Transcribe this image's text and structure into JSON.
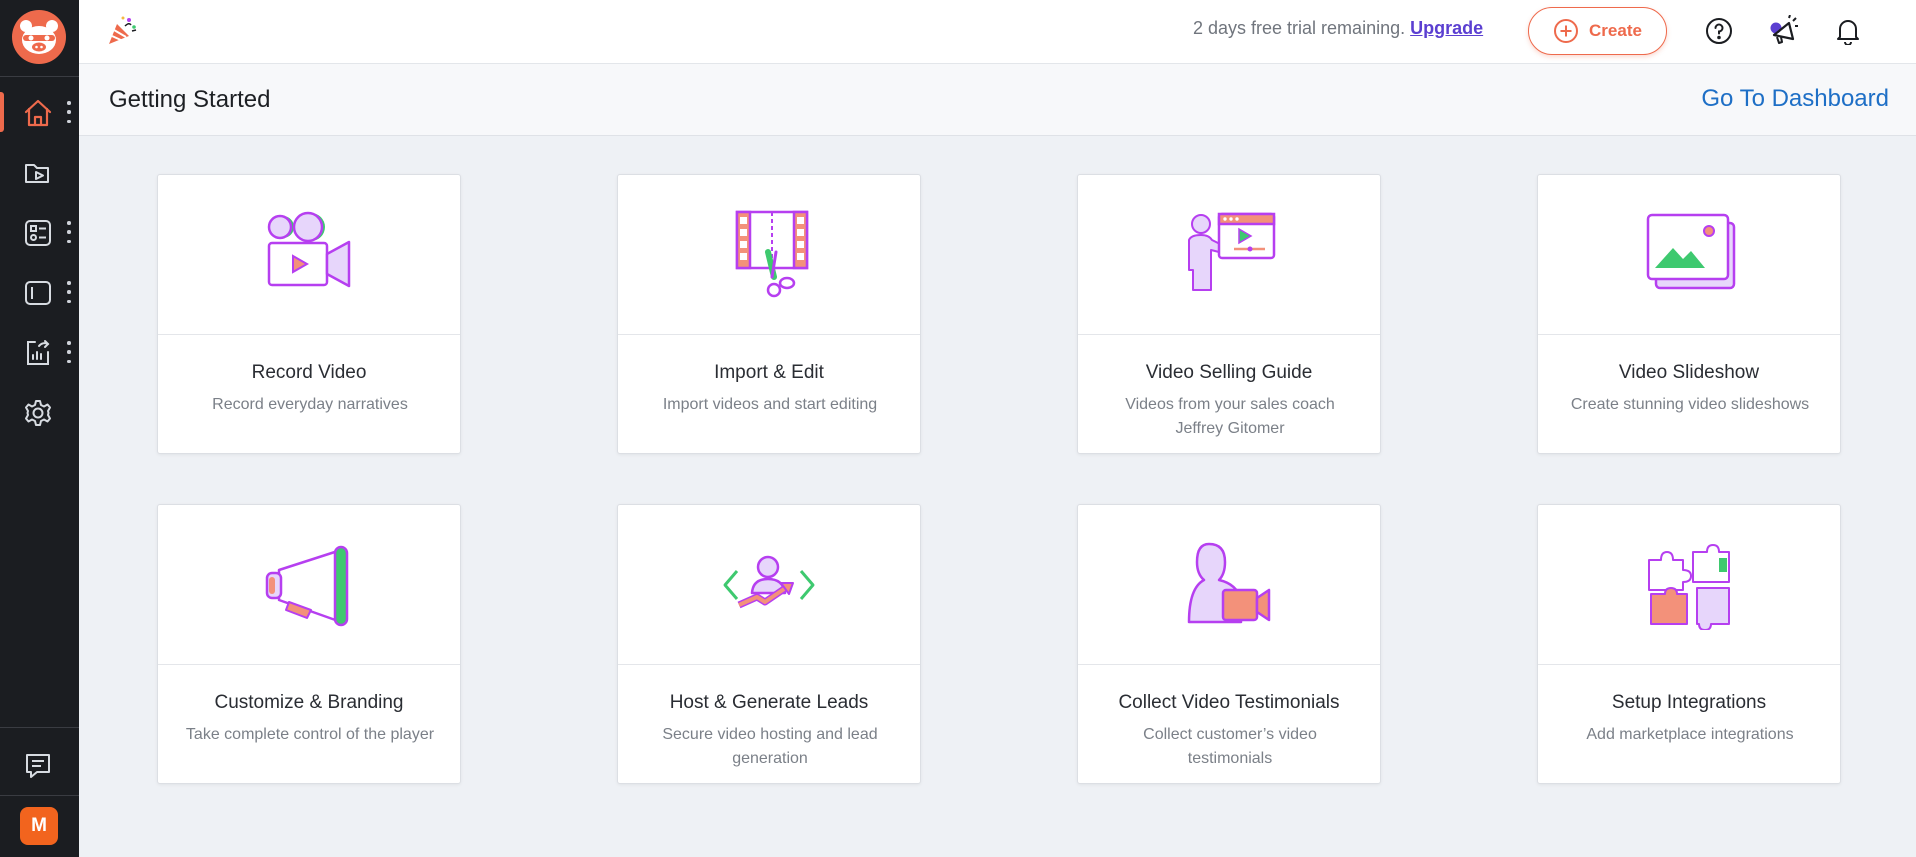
{
  "header": {
    "trial_text": "2 days free trial remaining.",
    "upgrade_label": "Upgrade",
    "create_label": "Create"
  },
  "page": {
    "title": "Getting Started",
    "dashboard_link": "Go To Dashboard"
  },
  "sidebar": {
    "avatar_initial": "M",
    "items": [
      {
        "icon": "home-icon",
        "active": true
      },
      {
        "icon": "video-folder-icon"
      },
      {
        "icon": "campaigns-icon"
      },
      {
        "icon": "page-layout-icon"
      },
      {
        "icon": "analytics-icon"
      },
      {
        "icon": "gear-icon"
      }
    ]
  },
  "cards": [
    {
      "title": "Record Video",
      "desc": "Record everyday narratives",
      "icon": "video-camera-icon"
    },
    {
      "title": "Import & Edit",
      "desc": "Import videos and start editing",
      "icon": "film-scissors-icon"
    },
    {
      "title": "Video Selling Guide",
      "desc": "Videos from your sales coach Jeffrey Gitomer",
      "icon": "presenter-icon"
    },
    {
      "title": "Video Slideshow",
      "desc": "Create stunning video slideshows",
      "icon": "image-stack-icon"
    },
    {
      "title": "Customize & Branding",
      "desc": "Take complete control of the player",
      "icon": "megaphone-icon"
    },
    {
      "title": "Host & Generate Leads",
      "desc": "Secure video hosting and lead generation",
      "icon": "lead-growth-icon"
    },
    {
      "title": "Collect Video Testimonials",
      "desc": "Collect customer’s video testimonials",
      "icon": "testimonial-icon"
    },
    {
      "title": "Setup Integrations",
      "desc": "Add marketplace integrations",
      "icon": "puzzle-icon"
    }
  ],
  "colors": {
    "accent": "#ee6a4c",
    "sidebar_bg": "#1b1d21",
    "link_blue": "#1e6fc6",
    "upgrade_purple": "#5b3fd1",
    "icon_purple": "#b63ff0",
    "icon_green": "#3ec96f",
    "icon_salmon": "#f3917a",
    "icon_lavender": "#e7d6fb"
  }
}
